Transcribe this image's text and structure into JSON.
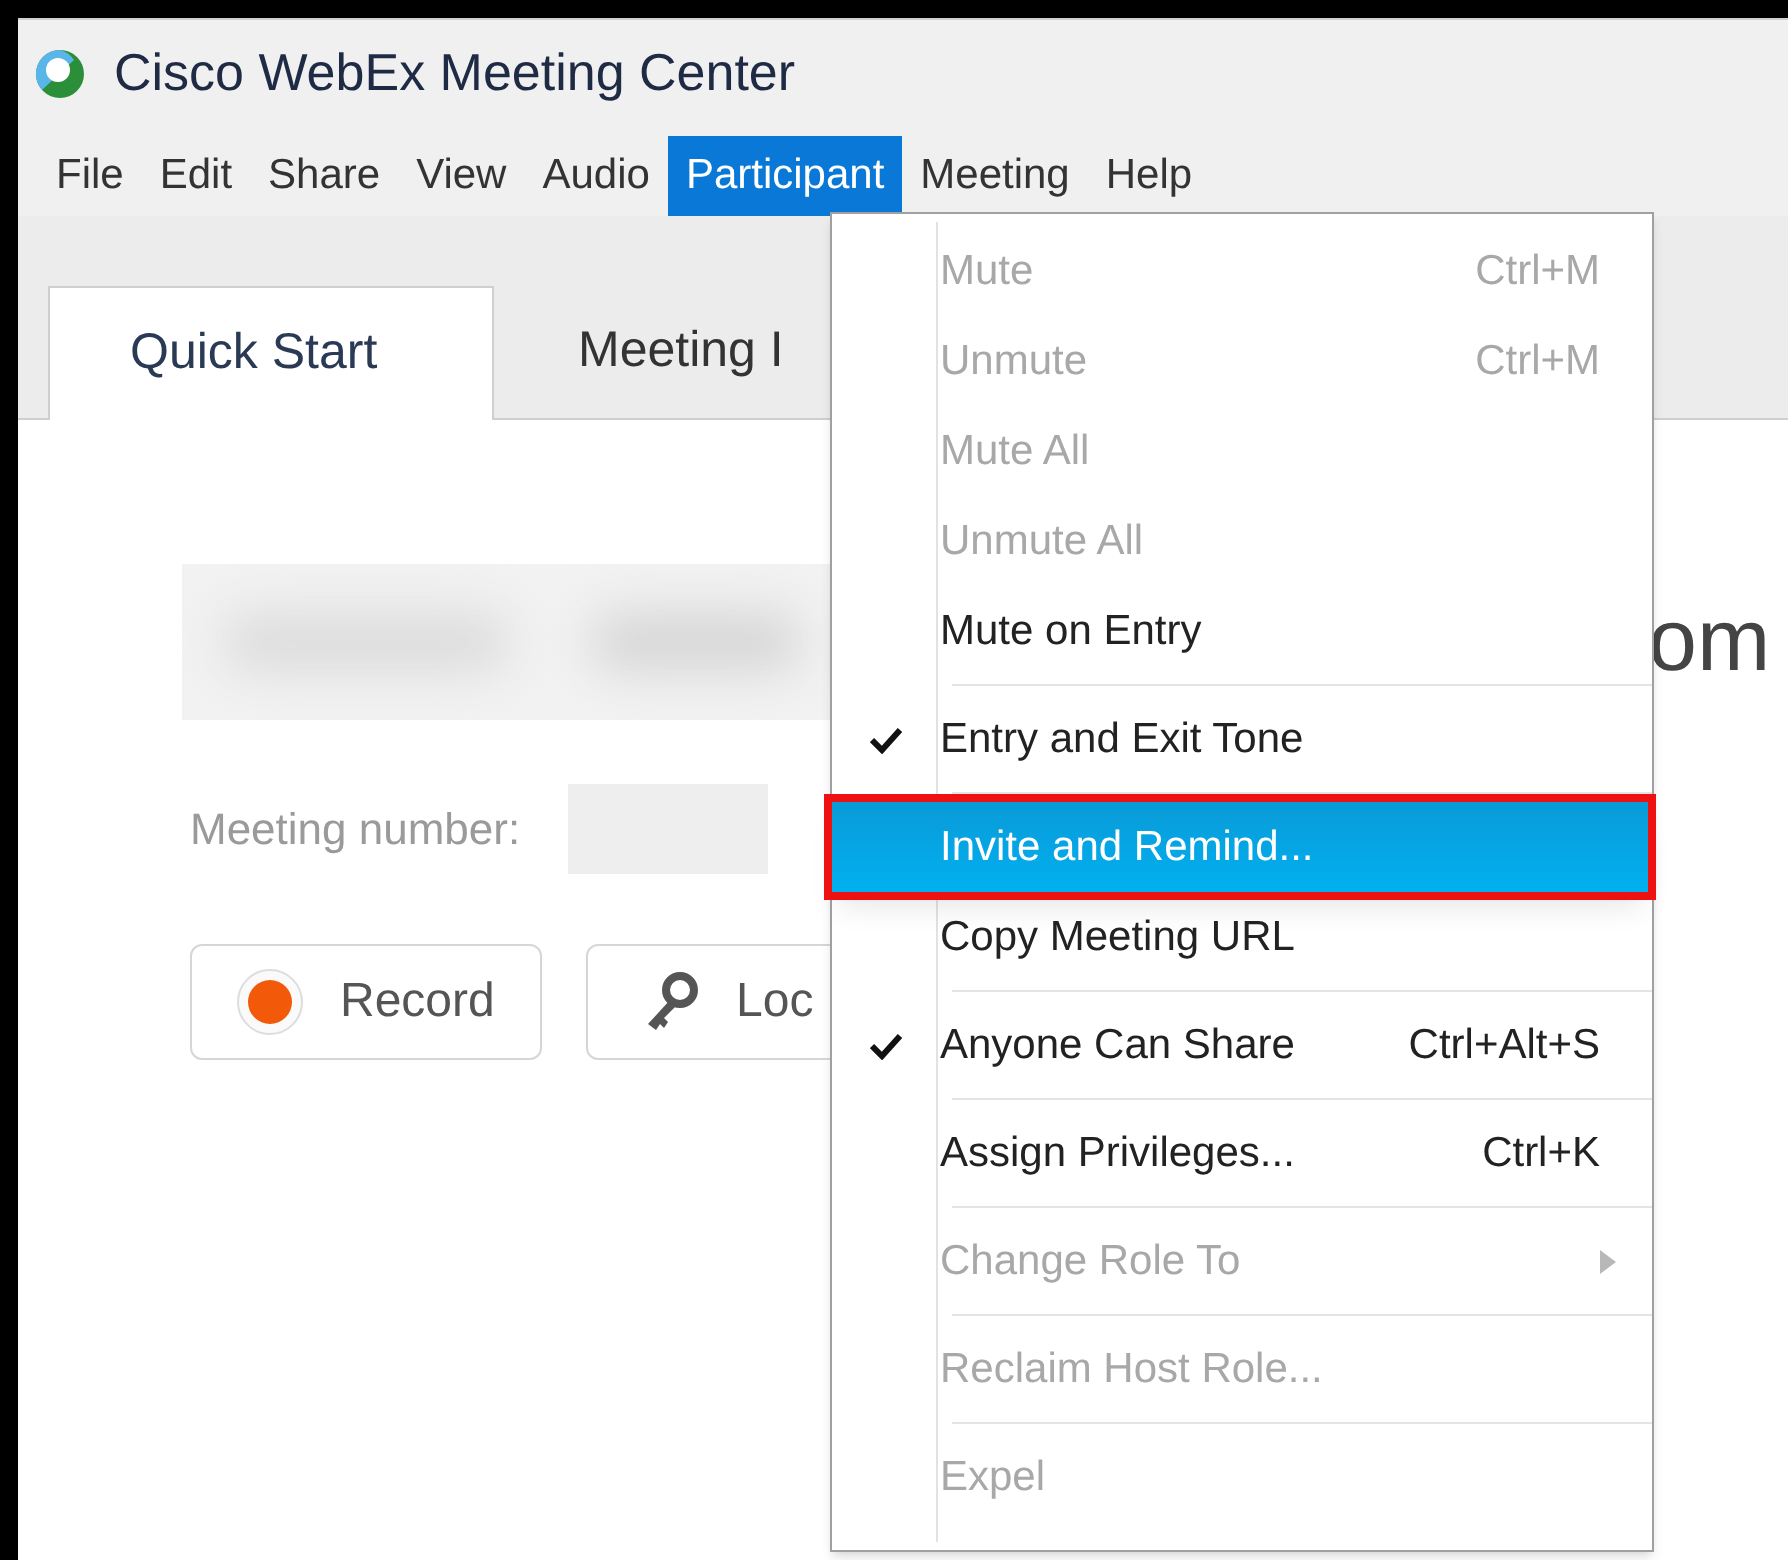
{
  "window": {
    "title": "Cisco WebEx Meeting Center"
  },
  "menu_bar": [
    {
      "label": "File",
      "selected": false
    },
    {
      "label": "Edit",
      "selected": false
    },
    {
      "label": "Share",
      "selected": false
    },
    {
      "label": "View",
      "selected": false
    },
    {
      "label": "Audio",
      "selected": false
    },
    {
      "label": "Participant",
      "selected": true
    },
    {
      "label": "Meeting",
      "selected": false
    },
    {
      "label": "Help",
      "selected": false
    }
  ],
  "tabs": [
    {
      "label": "Quick Start",
      "selected": true
    },
    {
      "label": "Meeting I",
      "selected": false
    }
  ],
  "content": {
    "heading_tail": "om",
    "meeting_number_label": "Meeting number:",
    "buttons": [
      {
        "label": "Record",
        "kind": "record"
      },
      {
        "label": "Loc",
        "kind": "lock"
      }
    ]
  },
  "dropdown": {
    "groups": [
      [
        {
          "label": "Mute",
          "shortcut": "Ctrl+M",
          "disabled": true,
          "checked": false,
          "selected": false
        },
        {
          "label": "Unmute",
          "shortcut": "Ctrl+M",
          "disabled": true,
          "checked": false,
          "selected": false
        },
        {
          "label": "Mute All",
          "disabled": true,
          "checked": false,
          "selected": false
        },
        {
          "label": "Unmute All",
          "disabled": true,
          "checked": false,
          "selected": false
        },
        {
          "label": "Mute on Entry",
          "disabled": false,
          "checked": false,
          "selected": false
        }
      ],
      [
        {
          "label": "Entry and Exit Tone",
          "disabled": false,
          "checked": true,
          "selected": false
        }
      ],
      [
        {
          "label": "Invite and Remind...",
          "disabled": false,
          "checked": false,
          "selected": true,
          "callout": true
        },
        {
          "label": "Copy Meeting URL",
          "disabled": false,
          "checked": false,
          "selected": false
        }
      ],
      [
        {
          "label": "Anyone Can Share",
          "shortcut": "Ctrl+Alt+S",
          "disabled": false,
          "checked": true,
          "selected": false
        }
      ],
      [
        {
          "label": "Assign Privileges...",
          "shortcut": "Ctrl+K",
          "disabled": false,
          "checked": false,
          "selected": false
        }
      ],
      [
        {
          "label": "Change Role To",
          "disabled": true,
          "checked": false,
          "selected": false,
          "submenu": true
        }
      ],
      [
        {
          "label": "Reclaim Host Role...",
          "disabled": true,
          "checked": false,
          "selected": false
        }
      ],
      [
        {
          "label": "Expel",
          "disabled": true,
          "checked": false,
          "selected": false
        }
      ]
    ]
  }
}
